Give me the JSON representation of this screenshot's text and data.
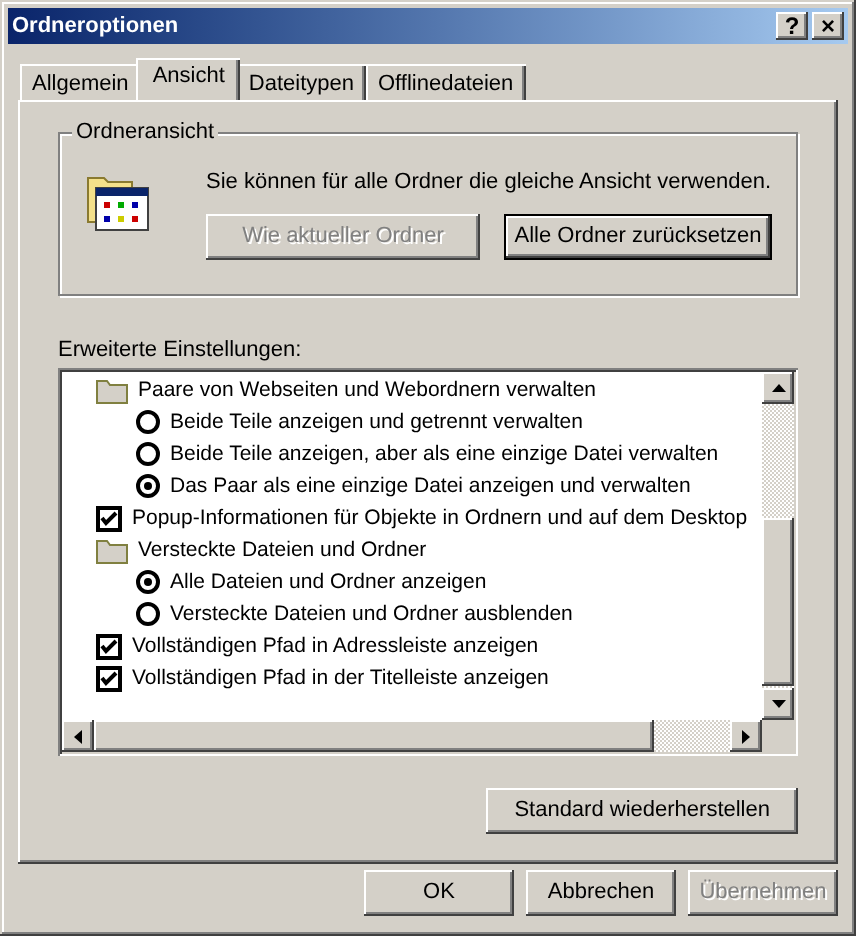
{
  "window": {
    "title": "Ordneroptionen",
    "title_buttons": [
      {
        "kind": "help",
        "label": "?"
      },
      {
        "kind": "close",
        "label": "×"
      }
    ]
  },
  "tabs": [
    {
      "label": "Allgemein",
      "selected": false
    },
    {
      "label": "Ansicht",
      "selected": true
    },
    {
      "label": "Dateitypen",
      "selected": false
    },
    {
      "label": "Offlinedateien",
      "selected": false
    }
  ],
  "folder_view": {
    "title": "Ordneransicht",
    "description": "Sie können für alle Ordner die gleiche Ansicht verwenden.",
    "buttons": [
      {
        "label": "Wie aktueller Ordner",
        "disabled": true,
        "default": false
      },
      {
        "label": "Alle Ordner zurücksetzen",
        "disabled": false,
        "default": true
      }
    ]
  },
  "advanced": {
    "label": "Erweiterte Einstellungen:",
    "items": [
      {
        "kind": "folder",
        "label": "Paare von Webseiten und Webordnern verwalten",
        "children": [
          {
            "kind": "radio",
            "label": "Beide Teile anzeigen und getrennt verwalten",
            "selected": false
          },
          {
            "kind": "radio",
            "label": "Beide Teile anzeigen, aber als eine einzige Datei verwalten",
            "selected": false
          },
          {
            "kind": "radio",
            "label": "Das Paar als eine einzige Datei anzeigen und verwalten",
            "selected": true
          }
        ]
      },
      {
        "kind": "checkbox",
        "label": "Popup-Informationen für Objekte in Ordnern und auf dem Desktop",
        "checked": true
      },
      {
        "kind": "folder",
        "label": "Versteckte Dateien und Ordner",
        "children": [
          {
            "kind": "radio",
            "label": "Alle Dateien und Ordner anzeigen",
            "selected": true
          },
          {
            "kind": "radio",
            "label": "Versteckte Dateien und Ordner ausblenden",
            "selected": false
          }
        ]
      },
      {
        "kind": "checkbox",
        "label": "Vollständigen Pfad in Adressleiste anzeigen",
        "checked": true
      },
      {
        "kind": "checkbox",
        "label": "Vollständigen Pfad in der Titelleiste anzeigen",
        "checked": true
      }
    ]
  },
  "restore_button": {
    "label": "Standard wiederherstellen"
  },
  "dialog_buttons": [
    {
      "label": "OK",
      "disabled": false
    },
    {
      "label": "Abbrechen",
      "disabled": false
    },
    {
      "label": "Übernehmen",
      "disabled": true
    }
  ]
}
